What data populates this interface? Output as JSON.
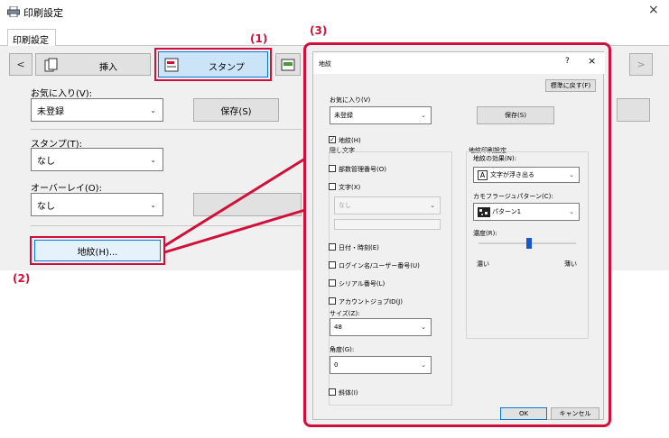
{
  "window": {
    "title": "印刷設定",
    "close_glyph": "×",
    "tab_label": "印刷設定"
  },
  "ribbon": {
    "prev_glyph": "<",
    "next_glyph": ">",
    "insert_label": "挿入",
    "stamp_label": "スタンプ"
  },
  "favorites": {
    "label": "お気に入り(V):",
    "value": "未登録",
    "save_label": "保存(S)"
  },
  "stamp_field": {
    "label": "スタンプ(T):",
    "value": "なし"
  },
  "overlay_field": {
    "label": "オーバーレイ(O):",
    "value": "なし"
  },
  "watermark_button": {
    "label": "地紋(H)..."
  },
  "callouts": {
    "one": "(1)",
    "two": "(2)",
    "three": "(3)"
  },
  "dialog": {
    "title": "地紋",
    "help_glyph": "?",
    "close_glyph": "×",
    "defaults_label": "標準に戻す(F)",
    "favorites_label": "お気に入り(V)",
    "favorites_value": "未登録",
    "save_label": "保存(S)",
    "watermark_check": "地紋(H)",
    "hidden_text_label": "隠し文字",
    "dept_code": "部数管理番号(O)",
    "text_label": "文字(X)",
    "text_value": "なし",
    "datetime": "日付・時刻(E)",
    "login_name": "ログイン名/ユーザー番号(U)",
    "serial": "シリアル番号(L)",
    "account_job": "アカウントジョブID(J)",
    "size_label": "サイズ(Z):",
    "size_value": "48",
    "angle_label": "角度(G):",
    "angle_value": "0",
    "italic": "斜体(I)",
    "settings_label": "地紋印刷設定",
    "effect_label": "地紋の効果(N):",
    "effect_value": "文字が浮き出る",
    "effect_icon_glyph": "A",
    "camo_label": "カモフラージュパターン(C):",
    "camo_value": "パターン1",
    "density_label": "濃度(R):",
    "density_dark": "濃い",
    "density_light": "薄い",
    "density_level": 0.52,
    "ok_label": "OK",
    "cancel_label": "キャンセル"
  },
  "colors": {
    "highlight": "#d0103a",
    "dialog_bg": "#f0f0f0",
    "button_face": "#e1e1e1",
    "slider_thumb": "#1a56c4"
  }
}
